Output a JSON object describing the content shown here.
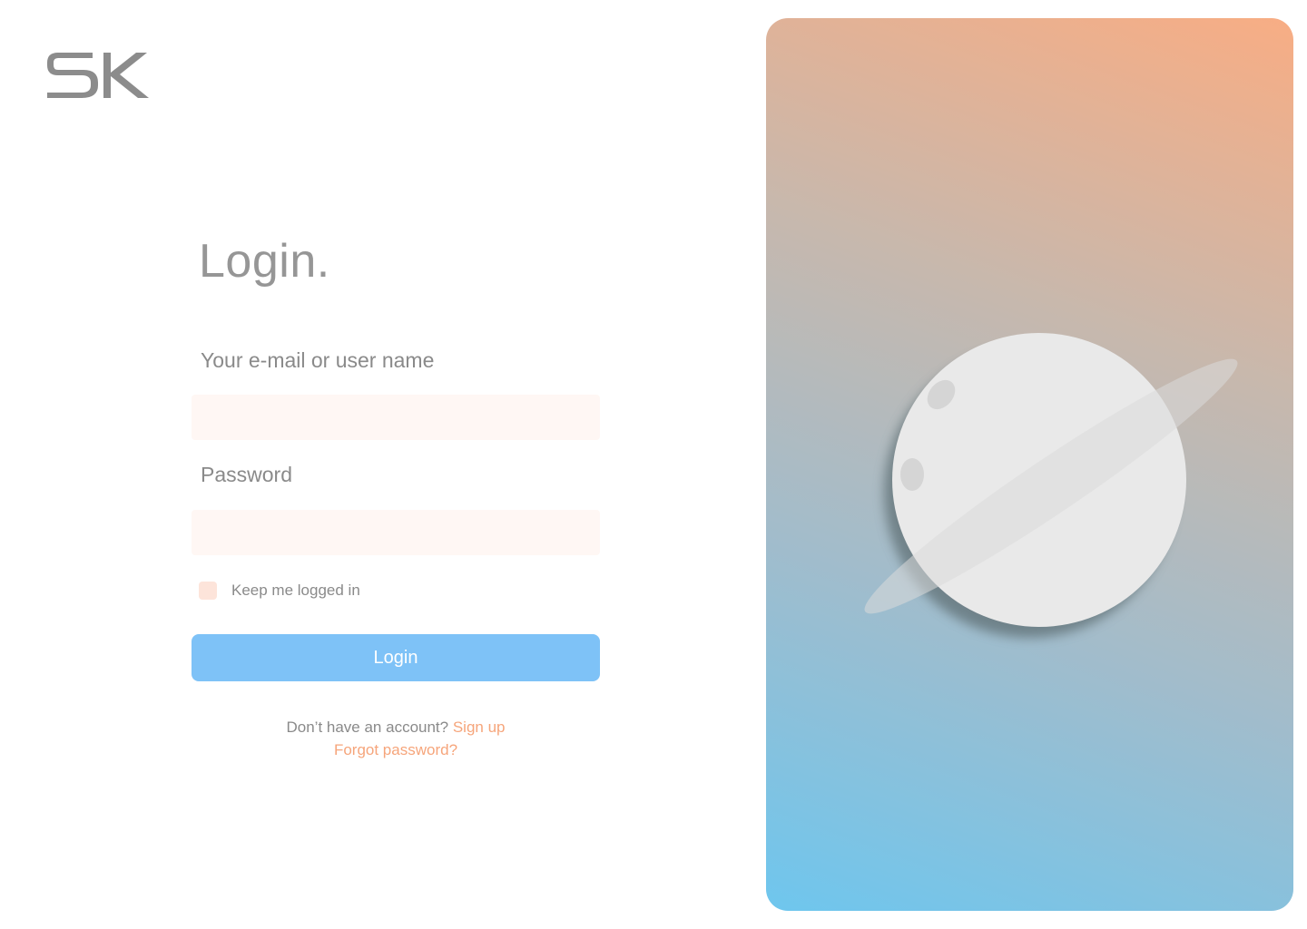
{
  "brand": {
    "logo_text": "SK"
  },
  "login": {
    "title": "Login.",
    "email_label": "Your e-mail or user name",
    "email_value": "",
    "email_placeholder": "",
    "password_label": "Password",
    "password_value": "",
    "password_placeholder": "",
    "keep_logged_in_label": "Keep me logged in",
    "keep_logged_in_checked": false,
    "submit_label": "Login",
    "no_account_text": "Don’t have an account?",
    "signup_link": "Sign up",
    "forgot_link": "Forgot password?"
  },
  "colors": {
    "title_text": "#969696",
    "label_text": "#8a8a8a",
    "field_background": "#fff7f4",
    "checkbox_background": "#fde4da",
    "button_background": "#7ec2f7",
    "link": "#f6a57b",
    "panel_gradient": [
      "#6ec6ee",
      "#a2bccb",
      "#c7b8ad",
      "#f8ad84"
    ]
  },
  "illustration": {
    "subject": "planet-with-ring"
  }
}
